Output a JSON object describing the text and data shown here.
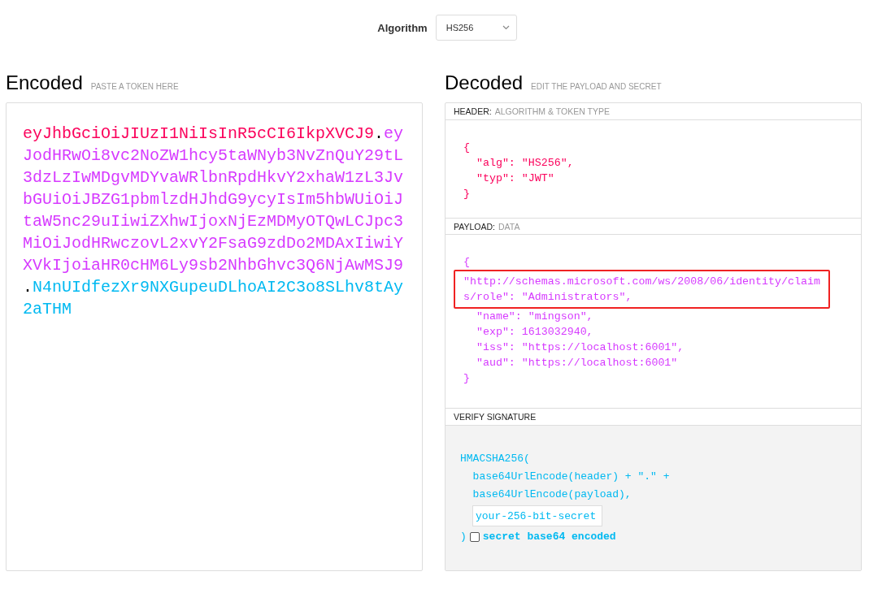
{
  "algorithm": {
    "label": "Algorithm",
    "value": "HS256"
  },
  "encoded": {
    "title": "Encoded",
    "subtitle": "PASTE A TOKEN HERE",
    "lines": [
      [
        {
          "kind": "header",
          "text": "eyJhbGciOiJIUzI1NiIsInR5cCI6IkpXVCJ9"
        },
        {
          "kind": "dot",
          "text": "."
        },
        {
          "kind": "payload",
          "text": "ey"
        }
      ],
      [
        {
          "kind": "payload",
          "text": "JodHRwOi8vc2NoZW1hcy5taWNyb3NvZnQuY29tL"
        }
      ],
      [
        {
          "kind": "payload",
          "text": "3dzLzIwMDgvMDYvaWRlbnRpdHkvY2xhaW1zL3Jv"
        }
      ],
      [
        {
          "kind": "payload",
          "text": "bGUiOiJBZG1pbmlzdHJhdG9ycyIsIm5hbWUiOiJ"
        }
      ],
      [
        {
          "kind": "payload",
          "text": "taW5nc29uIiwiZXhwIjoxNjEzMDMyOTQwLCJpc3"
        }
      ],
      [
        {
          "kind": "payload",
          "text": "MiOiJodHRwczovL2xvY2FsaG9zdDo2MDAxIiwiY"
        }
      ],
      [
        {
          "kind": "payload",
          "text": "XVkIjoiaHR0cHM6Ly9sb2NhbGhvc3Q6NjAwMSJ9"
        }
      ],
      [
        {
          "kind": "dot",
          "text": "."
        },
        {
          "kind": "signature",
          "text": "N4nUIdfezXr9NXGupeuDLhoAI2C3o8SLhv8tAy"
        }
      ],
      [
        {
          "kind": "signature",
          "text": "2aTHM"
        }
      ]
    ]
  },
  "decoded": {
    "title": "Decoded",
    "subtitle": "EDIT THE PAYLOAD AND SECRET",
    "header": {
      "label": "HEADER:",
      "sublabel": "ALGORITHM & TOKEN TYPE",
      "lines": [
        {
          "text": "{",
          "highlighted": false
        },
        {
          "text": "  \"alg\": \"HS256\",",
          "highlighted": false
        },
        {
          "text": "  \"typ\": \"JWT\"",
          "highlighted": false
        },
        {
          "text": "}",
          "highlighted": false
        }
      ]
    },
    "payload": {
      "label": "PAYLOAD:",
      "sublabel": "DATA",
      "lines": [
        {
          "text": "{",
          "highlighted": false
        },
        {
          "text": "\"http://schemas.microsoft.com/ws/2008/06/identity/claim",
          "highlighted": true
        },
        {
          "text": "s/role\": \"Administrators\",",
          "highlighted": true
        },
        {
          "text": "  \"name\": \"mingson\",",
          "highlighted": false
        },
        {
          "text": "  \"exp\": 1613032940,",
          "highlighted": false
        },
        {
          "text": "  \"iss\": \"https://localhost:6001\",",
          "highlighted": false
        },
        {
          "text": "  \"aud\": \"https://localhost:6001\"",
          "highlighted": false
        },
        {
          "text": "}",
          "highlighted": false
        }
      ]
    },
    "verify": {
      "label": "VERIFY SIGNATURE",
      "lines": [
        "HMACSHA256(",
        "  base64UrlEncode(header) + \".\" +",
        "  base64UrlEncode(payload),"
      ],
      "secret_placeholder": "your-256-bit-secret",
      "closing": ")",
      "checkbox": {
        "label": "secret base64 encoded",
        "checked": false
      }
    }
  }
}
